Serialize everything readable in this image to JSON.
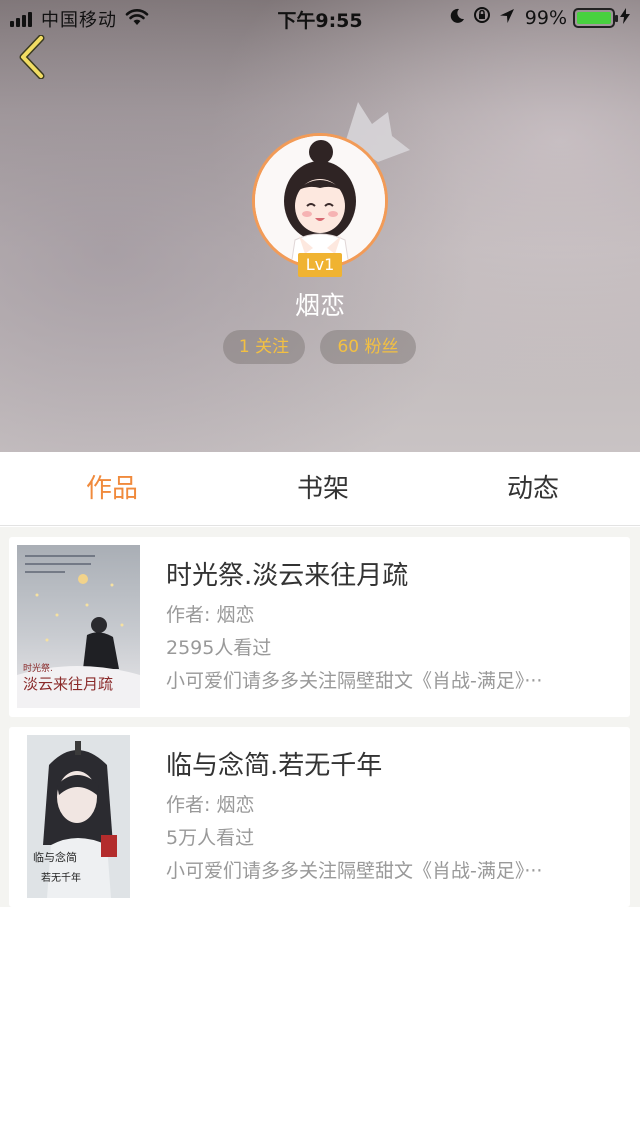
{
  "status_bar": {
    "carrier": "中国移动",
    "time": "下午9:55",
    "battery": "99%"
  },
  "profile": {
    "level": "Lv1",
    "name": "烟恋",
    "following": "1 关注",
    "fans": "60 粉丝"
  },
  "tabs": [
    {
      "label": "作品",
      "active": true
    },
    {
      "label": "书架",
      "active": false
    },
    {
      "label": "动态",
      "active": false
    }
  ],
  "books": [
    {
      "title": "时光祭.淡云来往月疏",
      "author": "作者: 烟恋",
      "views": "2595人看过",
      "description": "小可爱们请多多关注隔壁甜文《肖战-满足》···"
    },
    {
      "title": "临与念简.若无千年",
      "author": "作者: 烟恋",
      "views": "5万人看过",
      "description": "小可爱们请多多关注隔壁甜文《肖战-满足》···"
    }
  ],
  "colors": {
    "accent": "#f08a3c",
    "level_badge": "#f0b331",
    "stat_text": "#f3c042"
  }
}
